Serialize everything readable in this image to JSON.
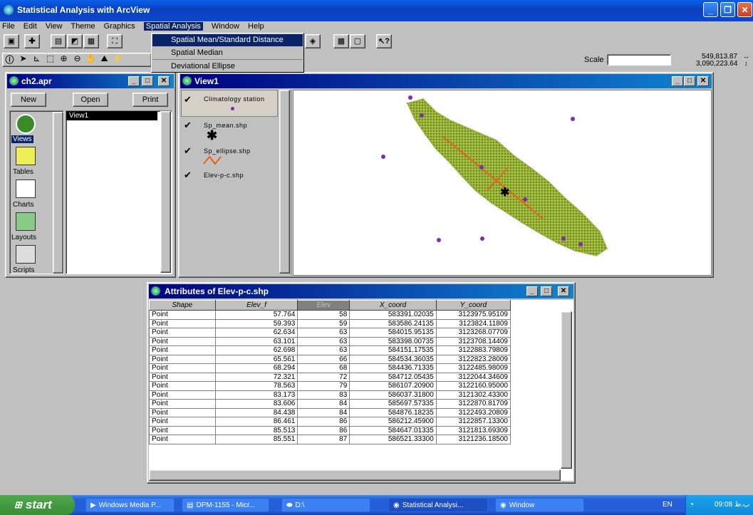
{
  "app": {
    "title": "Statistical Analysis with ArcView"
  },
  "menubar": [
    "File",
    "Edit",
    "View",
    "Theme",
    "Graphics",
    "Spatial Analysis",
    "Window",
    "Help"
  ],
  "dropdown": {
    "items": [
      "Spatial Mean/Standard Distance",
      "Spatial Median",
      "Deviational Ellipse"
    ],
    "selected": 0
  },
  "scale": {
    "label": "Scale 1:",
    "value": "",
    "coord_x": "549,813.87",
    "coord_y": "3,090,223.64"
  },
  "project": {
    "title": "ch2.apr",
    "buttons": [
      "New",
      "Open",
      "Print"
    ],
    "icons": [
      "Views",
      "Tables",
      "Charts",
      "Layouts",
      "Scripts"
    ],
    "items": [
      "View1"
    ]
  },
  "view": {
    "title": "View1",
    "themes": [
      "Climatology station",
      "Sp_mean.shp",
      "Sp_ellipse.shp",
      "Elev-p-c.shp"
    ]
  },
  "attributes": {
    "title": "Attributes of Elev-p-c.shp",
    "columns": [
      "Shape",
      "Elev_f",
      "Elev",
      "X_coord",
      "Y_coord"
    ],
    "rows": [
      [
        "Point",
        "57.764",
        "58",
        "583391.02035",
        "3123975.95109"
      ],
      [
        "Point",
        "59.393",
        "59",
        "583586.24135",
        "3123824.11809"
      ],
      [
        "Point",
        "62.634",
        "63",
        "584015.95135",
        "3123268.07709"
      ],
      [
        "Point",
        "63.101",
        "63",
        "583398.00735",
        "3123708.14409"
      ],
      [
        "Point",
        "62.698",
        "63",
        "584151.17535",
        "3122883.79809"
      ],
      [
        "Point",
        "65.561",
        "66",
        "584534.36035",
        "3122823.28009"
      ],
      [
        "Point",
        "68.294",
        "68",
        "584436.71335",
        "3122485.98009"
      ],
      [
        "Point",
        "72.321",
        "72",
        "584712.05435",
        "3122044.34609"
      ],
      [
        "Point",
        "78.563",
        "79",
        "586107.20900",
        "3122160.95000"
      ],
      [
        "Point",
        "83.173",
        "83",
        "586037.31800",
        "3121302.43300"
      ],
      [
        "Point",
        "83.606",
        "84",
        "585697.57335",
        "3122870.81709"
      ],
      [
        "Point",
        "84.438",
        "84",
        "584876.18235",
        "3122493.20809"
      ],
      [
        "Point",
        "86.461",
        "86",
        "586212.45900",
        "3122857.13300"
      ],
      [
        "Point",
        "85.513",
        "86",
        "584647.01335",
        "3121813.69309"
      ],
      [
        "Point",
        "85.551",
        "87",
        "586521.33300",
        "3121236.18500"
      ]
    ]
  },
  "taskbar": {
    "start": "start",
    "tasks": [
      "Windows Media P...",
      "DPM-1155 - Micr...",
      "D:\\",
      "Statistical Analysi...",
      "Window"
    ],
    "lang": "EN",
    "clock": "09:08 ب.ظ"
  },
  "colors": {
    "xp_blue": "#0a3fbd",
    "terrain": "#8aa82a",
    "station": "#7b2fa8",
    "ellipse": "#e8601c"
  }
}
